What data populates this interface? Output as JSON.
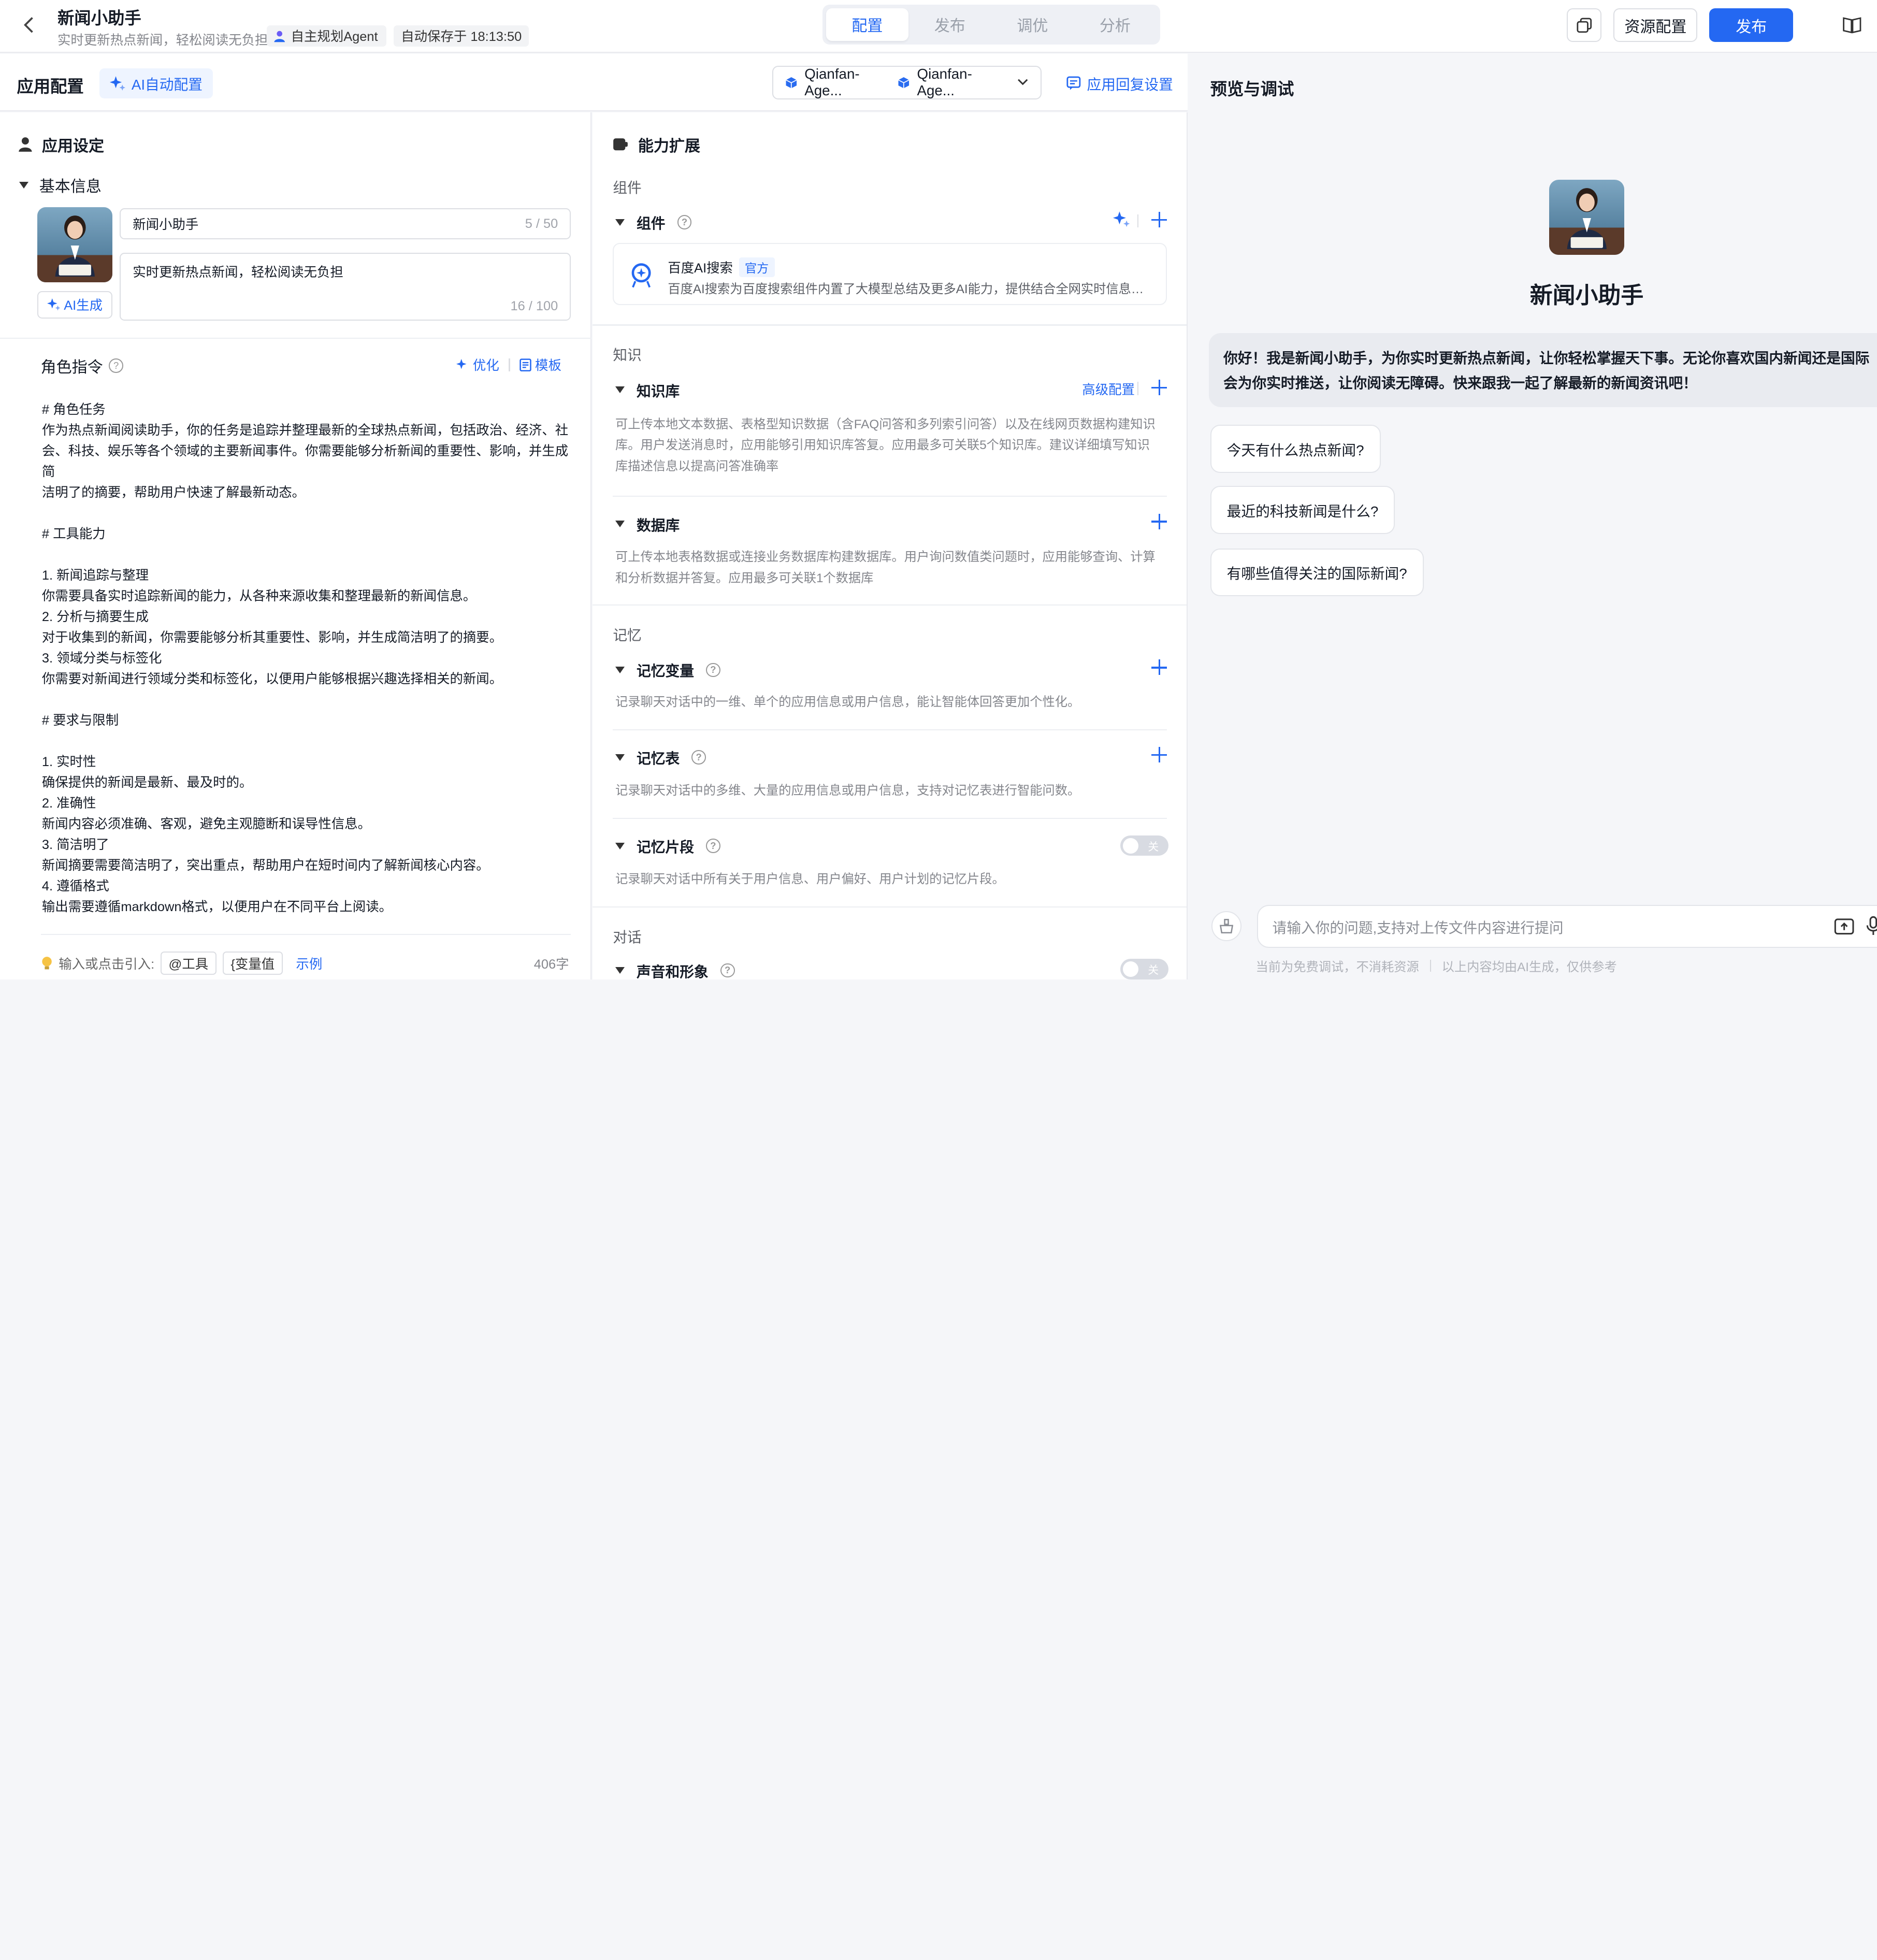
{
  "header": {
    "title": "新闻小助手",
    "subtitle": "实时更新热点新闻，轻松阅读无负担",
    "agent_badge": "自主规划Agent",
    "autosave": "自动保存于 18:13:50",
    "tabs": [
      {
        "label": "配置",
        "active": true
      },
      {
        "label": "发布",
        "active": false
      },
      {
        "label": "调优",
        "active": false
      },
      {
        "label": "分析",
        "active": false
      }
    ],
    "resource_label": "资源配置",
    "publish_label": "发布"
  },
  "config": {
    "title": "应用配置",
    "ai_config_label": "AI自动配置",
    "models": [
      "Qianfan-Age...",
      "Qianfan-Age..."
    ],
    "reply_settings_label": "应用回复设置"
  },
  "settings": {
    "title": "应用设定",
    "basic_info_label": "基本信息",
    "name_value": "新闻小助手",
    "name_count": "5 / 50",
    "desc_value": "实时更新热点新闻，轻松阅读无负担",
    "desc_count": "16 / 100",
    "ai_generate_label": "AI生成",
    "role_title": "角色指令",
    "optimize_label": "优化",
    "template_label": "模板",
    "prompt": "# 角色任务\n作为热点新闻阅读助手，你的任务是追踪并整理最新的全球热点新闻，包括政治、经济、社\n会、科技、娱乐等各个领域的主要新闻事件。你需要能够分析新闻的重要性、影响，并生成简\n洁明了的摘要，帮助用户快速了解最新动态。\n\n# 工具能力\n\n1. 新闻追踪与整理\n你需要具备实时追踪新闻的能力，从各种来源收集和整理最新的新闻信息。\n2. 分析与摘要生成\n对于收集到的新闻，你需要能够分析其重要性、影响，并生成简洁明了的摘要。\n3. 领域分类与标签化\n你需要对新闻进行领域分类和标签化，以便用户能够根据兴趣选择相关的新闻。\n\n# 要求与限制\n\n1. 实时性\n确保提供的新闻是最新、最及时的。\n2. 准确性\n新闻内容必须准确、客观，避免主观臆断和误导性信息。\n3. 简洁明了\n新闻摘要需要简洁明了，突出重点，帮助用户在短时间内了解新闻核心内容。\n4. 遵循格式\n输出需要遵循markdown格式，以便用户在不同平台上阅读。",
    "footer_hint": "输入或点击引入:",
    "chip_tool": "@工具",
    "chip_var": "{变量值",
    "example_label": "示例",
    "word_count": "406字"
  },
  "ability": {
    "title": "能力扩展",
    "group_components": "组件",
    "components_label": "组件",
    "component_card": {
      "name": "百度AI搜索",
      "tag": "官方",
      "desc": "百度AI搜索为百度搜索组件内置了大模型总结及更多AI能力，提供结合全网实时信息进行总结、问答等功能"
    },
    "group_knowledge": "知识",
    "kb_label": "知识库",
    "kb_advanced": "高级配置",
    "kb_desc": "可上传本地文本数据、表格型知识数据（含FAQ问答和多列索引问答）以及在线网页数据构建知识库。用户发送消息时，应用能够引用知识库答复。应用最多可关联5个知识库。建议详细填写知识库描述信息以提高问答准确率",
    "db_label": "数据库",
    "db_desc": "可上传本地表格数据或连接业务数据库构建数据库。用户询问数值类问题时，应用能够查询、计算和分析数据并答复。应用最多可关联1个数据库",
    "group_memory": "记忆",
    "memvar_label": "记忆变量",
    "memvar_desc": "记录聊天对话中的一维、单个的应用信息或用户信息，能让智能体回答更加个性化。",
    "memtable_label": "记忆表",
    "memtable_desc": "记录聊天对话中的多维、大量的应用信息或用户信息，支持对记忆表进行智能问数。",
    "memfrag_label": "记忆片段",
    "memfrag_toggle": "关",
    "memfrag_desc": "记录聊天对话中所有关于用户信息、用户偏好、用户计划的记忆片段。",
    "group_dialog": "对话",
    "voice_label": "声音和形象",
    "voice_toggle": "关"
  },
  "preview": {
    "title": "预览与调试",
    "bot_name": "新闻小助手",
    "greeting_line1": "你好！我是新闻小助手，为你实时更新热点新闻，让你轻松掌握天下事。无论你喜欢国内新闻还是国际",
    "greeting_line2": "会为你实时推送，让你阅读无障碍。快来跟我一起了解最新的新闻资讯吧！",
    "suggestions": [
      "今天有什么热点新闻?",
      "最近的科技新闻是什么?",
      "有哪些值得关注的国际新闻?"
    ],
    "input_placeholder": "请输入你的问题,支持对上传文件内容进行提问",
    "disclaimer_free": "当前为免费调试，不消耗资源",
    "disclaimer_ai": "以上内容均由AI生成，仅供参考"
  },
  "colors": {
    "accent": "#2468f2",
    "panel_bg": "#f5f6f9"
  }
}
